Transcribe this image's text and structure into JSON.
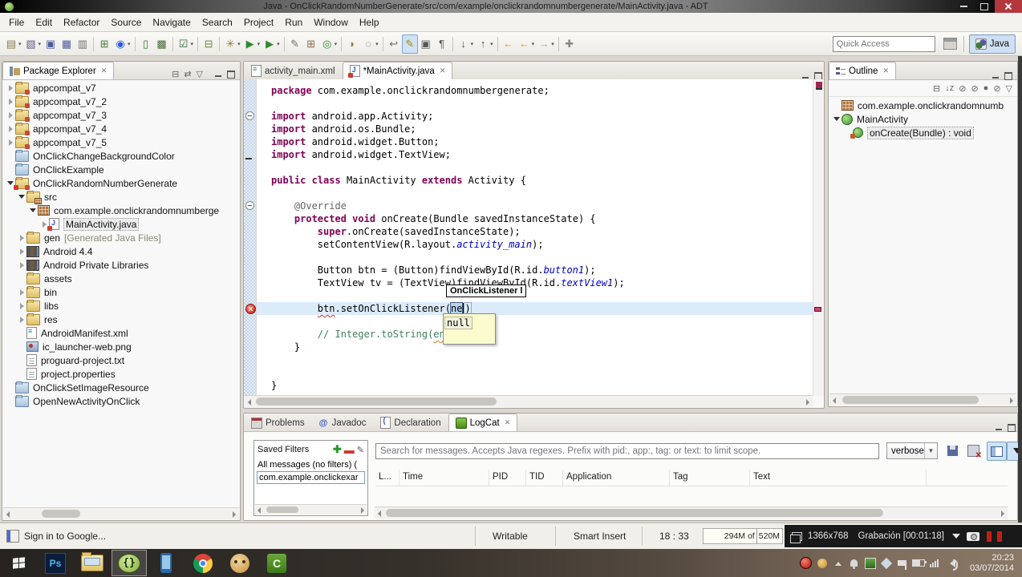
{
  "window": {
    "title": "Java - OnClickRandomNumberGenerate/src/com/example/onclickrandomnumbergenerate/MainActivity.java - ADT"
  },
  "menu": {
    "items": [
      "File",
      "Edit",
      "Refactor",
      "Source",
      "Navigate",
      "Search",
      "Project",
      "Run",
      "Window",
      "Help"
    ]
  },
  "toolbar": {
    "quick_access_placeholder": "Quick Access",
    "perspective_label": "Java",
    "icons": [
      {
        "name": "new-wizard",
        "glyph": "▤",
        "color": "#8a7a4a",
        "drop": true
      },
      {
        "name": "new-java-class-wizard",
        "glyph": "▧",
        "color": "#6a5a8a",
        "drop": true
      },
      {
        "name": "save",
        "glyph": "▣",
        "color": "#4a5a9a"
      },
      {
        "name": "save-all",
        "glyph": "▦",
        "color": "#4a5a9a"
      },
      {
        "name": "print",
        "glyph": "▥",
        "color": "#707070"
      },
      {
        "name": "android-sdk-manager",
        "glyph": "⊞",
        "color": "#4a7a3a",
        "sep": true
      },
      {
        "name": "avd-manager",
        "glyph": "◉",
        "color": "#2a5adf",
        "drop": true
      },
      {
        "name": "android-device",
        "glyph": "▯",
        "color": "#3a7a3a",
        "sep": true
      },
      {
        "name": "android-emulator",
        "glyph": "▩",
        "color": "#4a6a3a"
      },
      {
        "name": "run-last-launched",
        "glyph": "☑",
        "color": "#3a6a3a",
        "drop": true,
        "sep": true
      },
      {
        "name": "new-android-app",
        "glyph": "⊟",
        "color": "#6a8a3a",
        "sep": true
      },
      {
        "name": "debug",
        "glyph": "✳",
        "color": "#8a7a2a",
        "drop": true,
        "sep": true
      },
      {
        "name": "run",
        "glyph": "▶",
        "color": "#2e8b2e",
        "drop": true
      },
      {
        "name": "run-external-tools",
        "glyph": "▶",
        "color": "#2e8b2e",
        "drop": true
      },
      {
        "name": "java-search",
        "glyph": "✎",
        "color": "#707070",
        "sep": true
      },
      {
        "name": "new-java-package",
        "glyph": "⊞",
        "color": "#8a6a4a"
      },
      {
        "name": "new-java-class",
        "glyph": "◎",
        "color": "#2e8b2e",
        "drop": true
      },
      {
        "name": "open-type",
        "glyph": "◗",
        "color": "#8a7a3a",
        "sep": true
      },
      {
        "name": "search",
        "glyph": "◌",
        "color": "#666666",
        "drop": true
      },
      {
        "name": "last-edit-location",
        "glyph": "↩",
        "color": "#707070",
        "sep": true
      },
      {
        "name": "mark-occurrences",
        "glyph": "✎",
        "color": "#a88a00",
        "toggled": true
      },
      {
        "name": "show-source",
        "glyph": "▣",
        "color": "#555555"
      },
      {
        "name": "show-whitespace",
        "glyph": "¶",
        "color": "#555555"
      },
      {
        "name": "next-annotation",
        "glyph": "↓",
        "color": "#555555",
        "drop": true,
        "sep": true
      },
      {
        "name": "previous-annotation",
        "glyph": "↑",
        "color": "#555555",
        "drop": true
      },
      {
        "name": "back-to-mainactivity",
        "glyph": "←",
        "color": "#c8a020",
        "sep": true
      },
      {
        "name": "back",
        "glyph": "←",
        "color": "#c8a020",
        "drop": true
      },
      {
        "name": "forward",
        "glyph": "→",
        "color": "#aaaaaa",
        "drop": true
      },
      {
        "name": "pin-editor",
        "glyph": "✚",
        "color": "#888888",
        "sep": true
      }
    ]
  },
  "package_explorer": {
    "title": "Package Explorer",
    "items": [
      {
        "label": "appcompat_v7",
        "icon": "javaproj",
        "indent": 0,
        "state": "collapsed"
      },
      {
        "label": "appcompat_v7_2",
        "icon": "javaproj",
        "indent": 0,
        "state": "collapsed"
      },
      {
        "label": "appcompat_v7_3",
        "icon": "javaproj",
        "indent": 0,
        "state": "collapsed"
      },
      {
        "label": "appcompat_v7_4",
        "icon": "javaproj",
        "indent": 0,
        "state": "collapsed"
      },
      {
        "label": "appcompat_v7_5",
        "icon": "javaproj",
        "indent": 0,
        "state": "collapsed"
      },
      {
        "label": "OnClickChangeBackgroundColor",
        "icon": "closedproj",
        "indent": 0,
        "state": "leaf"
      },
      {
        "label": "OnClickExample",
        "icon": "closedproj",
        "indent": 0,
        "state": "leaf"
      },
      {
        "label": "OnClickRandomNumberGenerate",
        "icon": "javaproj",
        "indent": 0,
        "state": "expanded",
        "badge": true
      },
      {
        "label": "src",
        "icon": "src",
        "indent": 1,
        "state": "expanded"
      },
      {
        "label": "com.example.onclickrandomnumberge",
        "icon": "package",
        "indent": 2,
        "state": "expanded"
      },
      {
        "label": "MainActivity.java",
        "icon": "javafile",
        "indent": 3,
        "state": "collapsed",
        "badge": true,
        "selected": true
      },
      {
        "label": "gen",
        "icon": "gen",
        "indent": 1,
        "state": "collapsed",
        "note": "[Generated Java Files]"
      },
      {
        "label": "Android 4.4",
        "icon": "lib",
        "indent": 1,
        "state": "collapsed"
      },
      {
        "label": "Android Private Libraries",
        "icon": "lib",
        "indent": 1,
        "state": "collapsed"
      },
      {
        "label": "assets",
        "icon": "folder",
        "indent": 1,
        "state": "leaf"
      },
      {
        "label": "bin",
        "icon": "folder",
        "indent": 1,
        "state": "collapsed"
      },
      {
        "label": "libs",
        "icon": "folder",
        "indent": 1,
        "state": "collapsed"
      },
      {
        "label": "res",
        "icon": "folder",
        "indent": 1,
        "state": "collapsed"
      },
      {
        "label": "AndroidManifest.xml",
        "icon": "xmlfile",
        "indent": 1,
        "state": "leaf"
      },
      {
        "label": "ic_launcher-web.png",
        "icon": "img",
        "indent": 1,
        "state": "leaf"
      },
      {
        "label": "proguard-project.txt",
        "icon": "txt",
        "indent": 1,
        "state": "leaf"
      },
      {
        "label": "project.properties",
        "icon": "txt",
        "indent": 1,
        "state": "leaf"
      },
      {
        "label": "OnClickSetImageResource",
        "icon": "closedproj",
        "indent": 0,
        "state": "leaf"
      },
      {
        "label": "OpenNewActivityOnClick",
        "icon": "closedproj",
        "indent": 0,
        "state": "leaf"
      }
    ]
  },
  "editor": {
    "tabs": [
      {
        "label": "activity_main.xml",
        "icon": "xmlfile",
        "active": false
      },
      {
        "label": "*MainActivity.java",
        "icon": "javafile",
        "active": true,
        "closable": true
      }
    ],
    "tooltip_text": "OnClickListener l",
    "completion_item": "null",
    "code_lines": [
      {
        "segs": [
          [
            "k",
            "package"
          ],
          [
            "p",
            " com.example.onclickrandomnumbergenerate;"
          ]
        ]
      },
      {
        "segs": []
      },
      {
        "gutter": "fold",
        "segs": [
          [
            "k",
            "import"
          ],
          [
            "p",
            " android.app.Activity;"
          ]
        ]
      },
      {
        "segs": [
          [
            "k",
            "import"
          ],
          [
            "p",
            " android.os.Bundle;"
          ]
        ]
      },
      {
        "segs": [
          [
            "k",
            "import"
          ],
          [
            "p",
            " android.widget.Button;"
          ]
        ]
      },
      {
        "gutter": "stub",
        "segs": [
          [
            "k",
            "import"
          ],
          [
            "p",
            " android.widget.TextView;"
          ]
        ]
      },
      {
        "segs": []
      },
      {
        "segs": [
          [
            "k",
            "public"
          ],
          [
            "p",
            " "
          ],
          [
            "k",
            "class"
          ],
          [
            "p",
            " MainActivity "
          ],
          [
            "k",
            "extends"
          ],
          [
            "p",
            " Activity {"
          ]
        ]
      },
      {
        "segs": []
      },
      {
        "gutter": "fold",
        "segs": [
          [
            "a",
            "    @Override"
          ]
        ]
      },
      {
        "segs": [
          [
            "p",
            "    "
          ],
          [
            "k",
            "protected"
          ],
          [
            "p",
            " "
          ],
          [
            "k",
            "void"
          ],
          [
            "p",
            " onCreate(Bundle savedInstanceState) {"
          ]
        ]
      },
      {
        "segs": [
          [
            "p",
            "        "
          ],
          [
            "k",
            "super"
          ],
          [
            "p",
            ".onCreate(savedInstanceState);"
          ]
        ]
      },
      {
        "segs": [
          [
            "p",
            "        setContentView(R.layout."
          ],
          [
            "f",
            "activity_main"
          ],
          [
            "p",
            ");"
          ]
        ]
      },
      {
        "segs": []
      },
      {
        "segs": [
          [
            "p",
            "        Button btn = (Button)findViewById(R.id."
          ],
          [
            "f",
            "button1"
          ],
          [
            "p",
            ");"
          ]
        ]
      },
      {
        "segs": [
          [
            "p",
            "        TextView tv = (TextView)findViewById(R.id."
          ],
          [
            "f",
            "textView1"
          ],
          [
            "p",
            ");"
          ]
        ]
      },
      {
        "segs": []
      },
      {
        "gutter": "error",
        "current": true,
        "segs": [
          [
            "p",
            "        "
          ],
          [
            "e",
            "btn"
          ],
          [
            "p",
            ".setOnClickListener("
          ],
          [
            "sel",
            "ne"
          ],
          [
            "cur",
            ""
          ],
          [
            "br",
            ")"
          ]
        ]
      },
      {
        "segs": []
      },
      {
        "segs": [
          [
            "c",
            "        // Integer.toString("
          ],
          [
            "ce",
            "ent"
          ]
        ]
      },
      {
        "segs": [
          [
            "p",
            "    }"
          ]
        ]
      },
      {
        "segs": []
      },
      {
        "segs": []
      },
      {
        "segs": [
          [
            "p",
            "}"
          ]
        ]
      }
    ]
  },
  "outline": {
    "title": "Outline",
    "items": [
      {
        "label": "com.example.onclickrandomnumb",
        "icon": "package",
        "indent": 0,
        "state": "leaf"
      },
      {
        "label": "MainActivity",
        "icon": "class",
        "indent": 0,
        "state": "expanded"
      },
      {
        "label": "onCreate(Bundle) : void",
        "icon": "method",
        "indent": 1,
        "state": "leaf",
        "selected": true
      }
    ]
  },
  "bottom_panel": {
    "tabs": [
      {
        "label": "Problems",
        "icon": "problems",
        "active": false
      },
      {
        "label": "Javadoc",
        "icon": "javadoc",
        "active": false
      },
      {
        "label": "Declaration",
        "icon": "decl",
        "active": false
      },
      {
        "label": "LogCat",
        "icon": "logcat",
        "active": true,
        "closable": true
      }
    ],
    "logcat": {
      "saved_filters_title": "Saved Filters",
      "filter_items": [
        "All messages (no filters) (",
        "com.example.onclickexar"
      ],
      "search_placeholder": "Search for messages. Accepts Java regexes. Prefix with pid:, app:, tag: or text: to limit scope.",
      "level_value": "verbose",
      "columns": [
        "L...",
        "Time",
        "PID",
        "TID",
        "Application",
        "Tag",
        "Text"
      ]
    }
  },
  "status_bar": {
    "signin_label": "Sign in to Google...",
    "writable": "Writable",
    "insert_mode": "Smart Insert",
    "caret_position": "18 : 33",
    "heap_used": "294M of",
    "heap_total": "520M"
  },
  "recorder_overlay": {
    "resolution": "1366x768",
    "recording_label": "Grabación [00:01:18]"
  },
  "taskbar": {
    "apps": [
      {
        "name": "photoshop",
        "glyph": "Ps"
      },
      {
        "name": "file-explorer"
      },
      {
        "name": "eclipse-adt",
        "glyph": "{}",
        "active": true
      },
      {
        "name": "phone-tool"
      },
      {
        "name": "chrome"
      },
      {
        "name": "messenger"
      },
      {
        "name": "camtasia",
        "glyph": "C"
      }
    ],
    "tray": [
      "record",
      "character",
      "hidden-icons",
      "notifications",
      "green-app",
      "network",
      "action-center",
      "battery",
      "signal",
      "volume"
    ],
    "clock_time": "20:23",
    "clock_date": "03/07/2014"
  }
}
